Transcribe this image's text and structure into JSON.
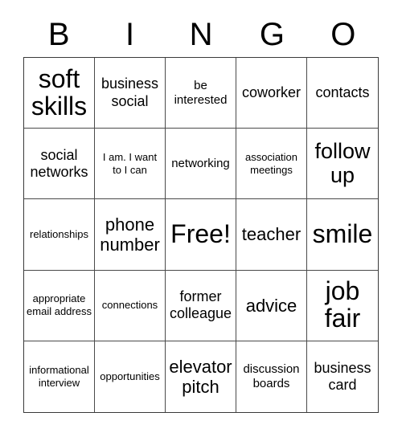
{
  "header": {
    "letters": [
      "B",
      "I",
      "N",
      "G",
      "O"
    ]
  },
  "grid": {
    "rows": [
      [
        {
          "text": "soft skills",
          "size": "xxl"
        },
        {
          "text": "business social",
          "size": "m"
        },
        {
          "text": "be interested",
          "size": "s"
        },
        {
          "text": "coworker",
          "size": "m"
        },
        {
          "text": "contacts",
          "size": "m"
        }
      ],
      [
        {
          "text": "social networks",
          "size": "m"
        },
        {
          "text": "I am. I want to I can",
          "size": "xs"
        },
        {
          "text": "networking",
          "size": "s"
        },
        {
          "text": "association meetings",
          "size": "xs"
        },
        {
          "text": "follow up",
          "size": "xl"
        }
      ],
      [
        {
          "text": "relationships",
          "size": "xs"
        },
        {
          "text": "phone number",
          "size": "l"
        },
        {
          "text": "Free!",
          "size": "xxl"
        },
        {
          "text": "teacher",
          "size": "l"
        },
        {
          "text": "smile",
          "size": "xxl"
        }
      ],
      [
        {
          "text": "appropriate email address",
          "size": "xs"
        },
        {
          "text": "connections",
          "size": "xs"
        },
        {
          "text": "former colleague",
          "size": "m"
        },
        {
          "text": "advice",
          "size": "l"
        },
        {
          "text": "job fair",
          "size": "xxl"
        }
      ],
      [
        {
          "text": "informational interview",
          "size": "xs"
        },
        {
          "text": "opportunities",
          "size": "xs"
        },
        {
          "text": "elevator pitch",
          "size": "l"
        },
        {
          "text": "discussion boards",
          "size": "s"
        },
        {
          "text": "business card",
          "size": "m"
        }
      ]
    ]
  },
  "colors": {
    "background": "#ffffff",
    "text": "#000000",
    "grid_line": "#4a4a4a",
    "outer_border": "#3a3a3a"
  }
}
